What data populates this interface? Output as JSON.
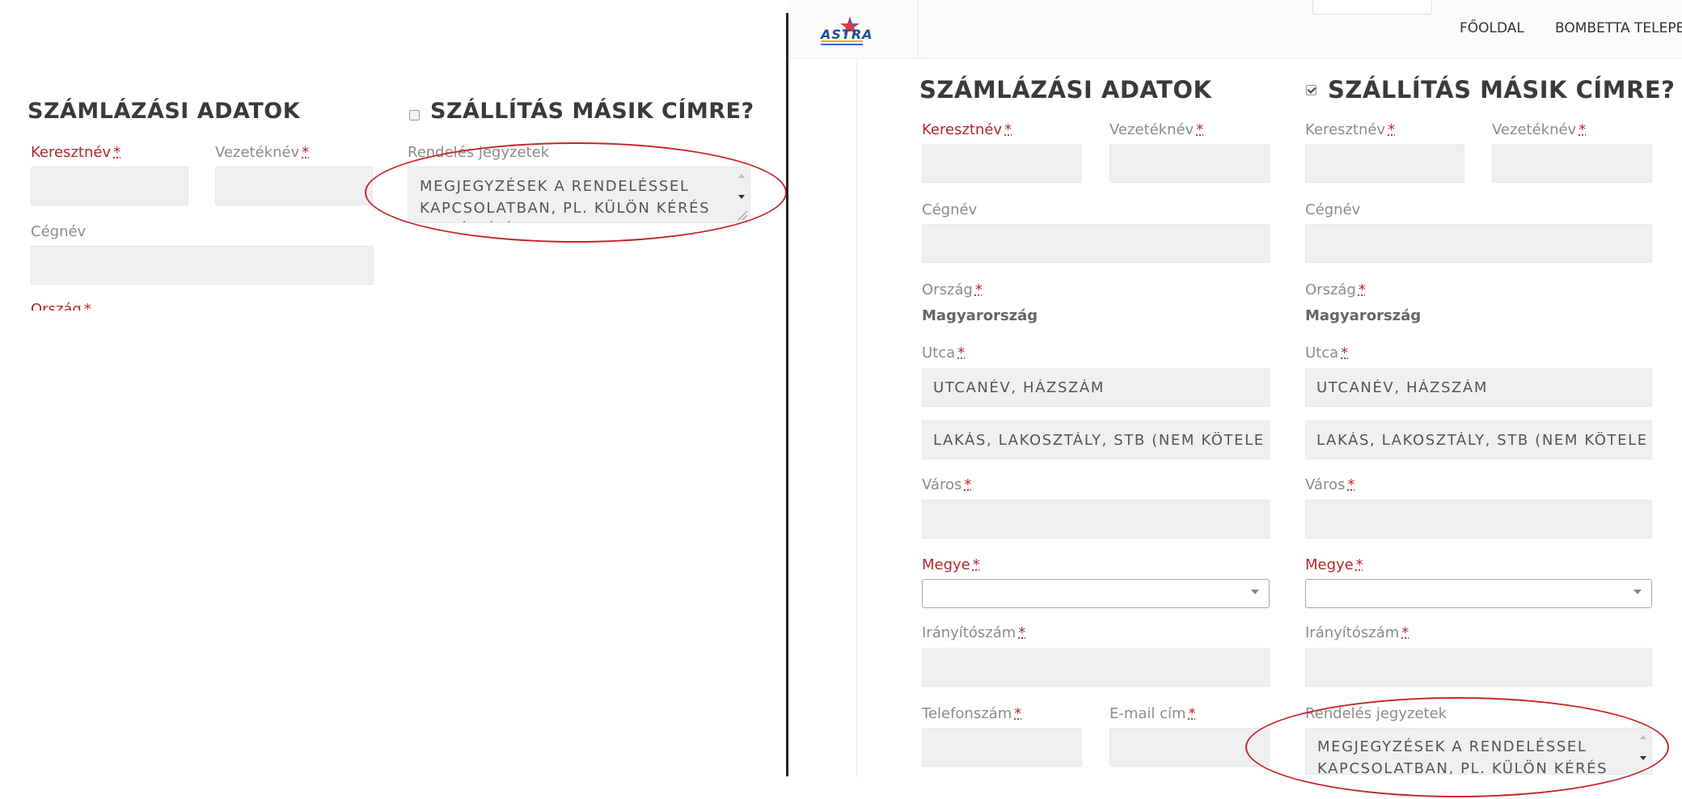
{
  "left_panel": {
    "billing_heading": "SZÁMLÁZÁSI ADATOK",
    "shipping_heading": "SZÁLLÍTÁS MÁSIK CÍMRE?",
    "shipping_checked": false,
    "first_name_label": "Keresztnév",
    "last_name_label": "Vezetéknév",
    "company_label": "Cégnév",
    "country_label_partial": "Ország",
    "order_notes_label": "Rendelés jegyzetek",
    "order_notes_placeholder": "MEGJEGYZÉSEK A RENDELÉSSEL KAPCSOLATBAN, PL. KÜLÖN KÉRÉS A SZÁLLÍTÁSSAL KAPCSOLATBAN"
  },
  "right_panel": {
    "logo_text": "ASTRA",
    "nav": {
      "home": "FŐOLDAL",
      "second": "BOMBETTA TELEPE"
    },
    "required_mark": "*",
    "billing": {
      "heading": "SZÁMLÁZÁSI ADATOK",
      "first_name_label": "Keresztnév",
      "last_name_label": "Vezetéknév",
      "company_label": "Cégnév",
      "country_label": "Ország",
      "country_value": "Magyarország",
      "street_label": "Utca",
      "street_placeholder": "UTCANÉV, HÁZSZÁM",
      "apartment_placeholder": "LAKÁS, LAKOSZTÁLY, STB (NEM KÖTELEZŐ)",
      "city_label": "Város",
      "county_label": "Megye",
      "county_value": "",
      "zip_label": "Irányítószám",
      "phone_label": "Telefonszám",
      "email_label": "E-mail cím"
    },
    "shipping": {
      "heading": "SZÁLLÍTÁS MÁSIK CÍMRE?",
      "checked": true,
      "first_name_label": "Keresztnév",
      "last_name_label": "Vezetéknév",
      "company_label": "Cégnév",
      "country_label": "Ország",
      "country_value": "Magyarország",
      "street_label": "Utca",
      "street_placeholder": "UTCANÉV, HÁZSZÁM",
      "apartment_placeholder": "LAKÁS, LAKOSZTÁLY, STB (NEM KÖTELEZŐ)",
      "city_label": "Város",
      "county_label": "Megye",
      "county_value": "",
      "zip_label": "Irányítószám",
      "order_notes_label": "Rendelés jegyzetek",
      "order_notes_placeholder": "MEGJEGYZÉSEK A RENDELÉSSEL KAPCSOLATBAN, PL. KÜLÖN KÉRÉS A SZÁLLÍTÁSSAL KAPCSOLATBAN"
    }
  },
  "colors": {
    "required_red": "#b3262b",
    "highlight_ellipse": "#c8242a",
    "field_bg": "#f0f0f0",
    "heading": "#3a3a3a"
  }
}
